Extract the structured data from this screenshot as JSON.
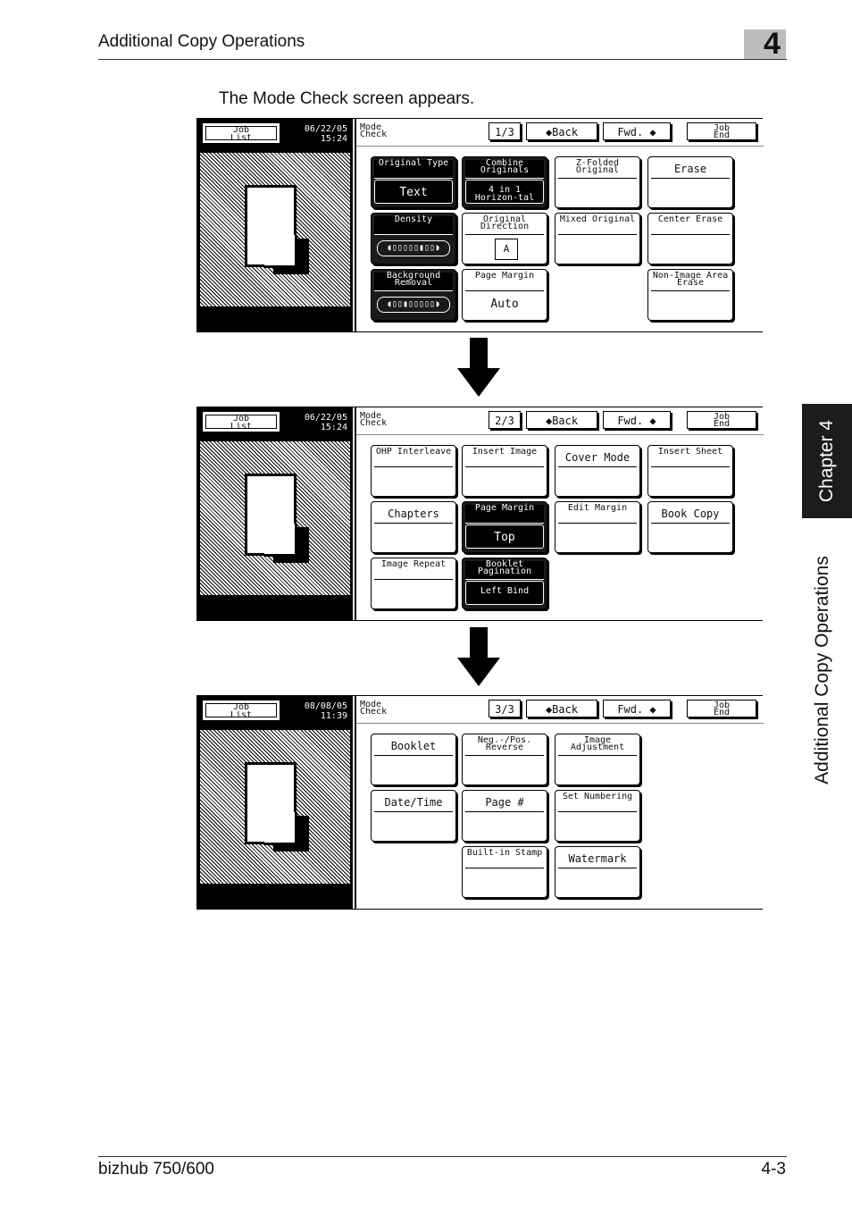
{
  "header": {
    "title": "Additional Copy Operations",
    "chapter_number": "4"
  },
  "side": {
    "chapter": "Chapter 4",
    "section": "Additional Copy Operations"
  },
  "intro": "The Mode Check screen appears.",
  "footer": {
    "model": "bizhub 750/600",
    "page": "4-3"
  },
  "screens": [
    {
      "job_list": [
        "Job",
        "List"
      ],
      "date": "06/22/05",
      "time": "15:24",
      "mode_check": [
        "Mode",
        "Check"
      ],
      "page": "1/3",
      "back": "◆Back",
      "fwd": "Fwd. ◆",
      "job_end": [
        "Job",
        "End"
      ],
      "buttons": [
        {
          "label": "Original Type",
          "value": "Text",
          "on": true
        },
        {
          "label": "Combine Originals",
          "value": "4 in 1 Horizon-tal",
          "on": true
        },
        {
          "label": "Z-Folded Original",
          "value": "",
          "on": false
        },
        {
          "label": "Erase",
          "value": "",
          "on": false
        },
        {
          "label": "Density",
          "value": "◖▯▯▯▯▯▮▯▯◗",
          "on": true
        },
        {
          "label": "Original Direction",
          "value": "A",
          "on": false
        },
        {
          "label": "Mixed Original",
          "value": "",
          "on": false
        },
        {
          "label": "Center Erase",
          "value": "",
          "on": false
        },
        {
          "label": "Background Removal",
          "value": "◖▯▯▮▯▯▯▯▯◗",
          "on": true
        },
        {
          "label": "Page Margin",
          "value": "Auto",
          "on": false
        },
        {
          "label": "Non-Image Area Erase",
          "value": "",
          "on": false
        }
      ]
    },
    {
      "job_list": [
        "Job",
        "List"
      ],
      "date": "06/22/05",
      "time": "15:24",
      "mode_check": [
        "Mode",
        "Check"
      ],
      "page": "2/3",
      "back": "◆Back",
      "fwd": "Fwd. ◆",
      "job_end": [
        "Job",
        "End"
      ],
      "buttons": [
        {
          "label": "OHP Interleave",
          "value": "",
          "on": false
        },
        {
          "label": "Insert Image",
          "value": "",
          "on": false
        },
        {
          "label": "Cover Mode",
          "value": "",
          "on": false
        },
        {
          "label": "Insert Sheet",
          "value": "",
          "on": false
        },
        {
          "label": "Chapters",
          "value": "",
          "on": false
        },
        {
          "label": "Page Margin",
          "value": "Top",
          "on": true
        },
        {
          "label": "Edit Margin",
          "value": "",
          "on": false
        },
        {
          "label": "Book Copy",
          "value": "",
          "on": false
        },
        {
          "label": "Image Repeat",
          "value": "",
          "on": false
        },
        {
          "label": "Booklet Pagination",
          "value": "Left Bind",
          "on": true
        }
      ]
    },
    {
      "job_list": [
        "Job",
        "List"
      ],
      "date": "08/08/05",
      "time": "11:39",
      "mode_check": [
        "Mode",
        "Check"
      ],
      "page": "3/3",
      "back": "◆Back",
      "fwd": "Fwd. ◆",
      "job_end": [
        "Job",
        "End"
      ],
      "buttons": [
        {
          "label": "Booklet",
          "value": "",
          "on": false
        },
        {
          "label": "Neg.-/Pos. Reverse",
          "value": "",
          "on": false
        },
        {
          "label": "Image Adjustment",
          "value": "",
          "on": false
        },
        {
          "label": "Date/Time",
          "value": "",
          "on": false
        },
        {
          "label": "Page #",
          "value": "",
          "on": false
        },
        {
          "label": "Set Numbering",
          "value": "",
          "on": false
        },
        {
          "label": "Built-in Stamp",
          "value": "",
          "on": false
        },
        {
          "label": "Watermark",
          "value": "",
          "on": false
        }
      ]
    }
  ]
}
